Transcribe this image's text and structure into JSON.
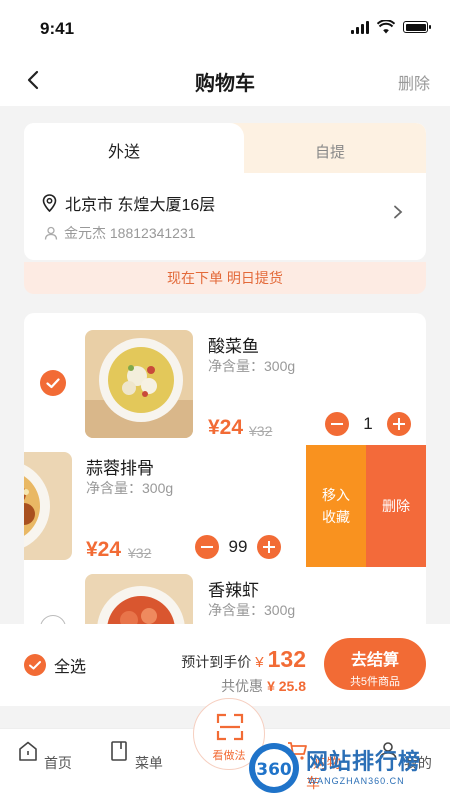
{
  "status": {
    "time": "9:41"
  },
  "nav": {
    "title": "购物车",
    "delete_label": "删除"
  },
  "delivery": {
    "tab_delivery": "外送",
    "tab_pickup": "自提",
    "address": "北京市 东煌大厦16层",
    "contact": "金元杰  18812341231"
  },
  "notice": "现在下单 明日提货",
  "items": [
    {
      "name": "酸菜鱼",
      "spec": "净含量：300g",
      "price": "¥24",
      "old_price": "¥32",
      "qty": "1",
      "checked": true
    },
    {
      "name": "蒜蓉排骨",
      "spec": "净含量：300g",
      "price": "¥24",
      "old_price": "¥32",
      "qty": "99",
      "checked": false
    },
    {
      "name": "香辣虾",
      "spec": "净含量：300g",
      "checked": false
    }
  ],
  "swipe_actions": {
    "move_label": "移入\n收藏",
    "delete_label": "删除"
  },
  "checkout": {
    "select_all": "全选",
    "est_label": "预计到手价",
    "currency": "¥",
    "total": "132",
    "discount_label": "共优惠",
    "discount": "¥ 25.8",
    "button_label": "去结算",
    "button_sub": "共5件商品"
  },
  "tabbar": {
    "home": "首页",
    "menu": "菜单",
    "scan": "看做法",
    "cart": "购物车",
    "mine": "我的"
  },
  "watermark": {
    "name": "网站排行榜",
    "url": "WANGZHAN360.CN",
    "badge": "360"
  },
  "colors": {
    "accent": "#f26b35",
    "orange": "#f9921f",
    "pickup_tab": "#fdf1e2",
    "notice_bg": "#fdebe3"
  }
}
